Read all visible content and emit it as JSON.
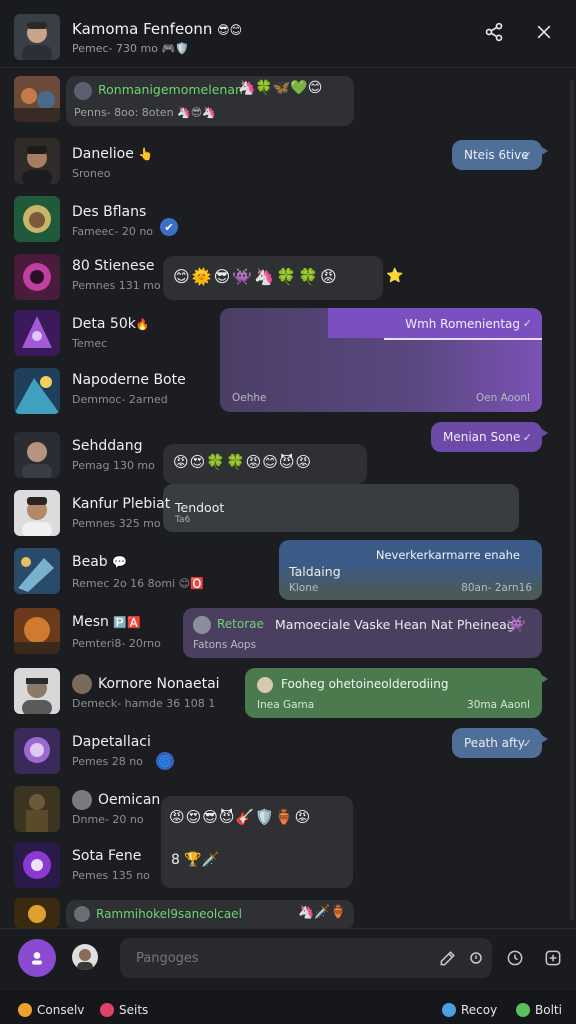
{
  "header": {
    "title": "Kamoma Fenfeonn",
    "title_emoji": "😎😊",
    "subtitle": "Pemec- 730 mo",
    "subtitle_emoji": "🎮🛡️",
    "share_icon": "share-icon",
    "close_icon": "close-icon"
  },
  "rows": [
    {
      "name": "Ronmanigemomelenan",
      "name_color": "#6fd36f",
      "emojis": "🦄🍀🦋💚😊",
      "sub": "Penns- 8oo: 8oten",
      "sub_emoji": "🦄😎🦄"
    },
    {
      "name": "Danelioe",
      "name_emoji": "👆",
      "sub": "Sroneo",
      "bubble": "Nteis 6tive",
      "tick": "✓"
    },
    {
      "name": "Des Bflans",
      "sub": "Fameec- 20 no",
      "badge": "✔"
    },
    {
      "name": "80 Stienese",
      "sub": "Pemnes 131 mo",
      "emojis": "😊🌞😎👾🦄🍀🍀😡",
      "side_emoji": "⭐"
    },
    {
      "name": "Deta 50k",
      "name_emoji": "🔥",
      "sub": "Temec",
      "bubble": "Wmh Romenientag",
      "tick": "✓"
    },
    {
      "name": "Napoderne Bote",
      "sub": "Demmoc- 2arned",
      "meta_left": "Oehhe",
      "meta_right": "Oen Aoonl"
    },
    {
      "bubble": "Menian Sone",
      "tick": "✓"
    },
    {
      "name": "Sehddang",
      "sub": "Pemag 130 mo",
      "emojis": "😡😍🍀🍀😡😊😈😡",
      "bubble": "Tendoot",
      "bubble2": "Ta6"
    },
    {
      "name": "Kanfur Plebiat",
      "sub": "Pemnes 325 mo"
    },
    {
      "name": "Beab",
      "name_emoji": "💬",
      "sub": "Remec 2o 16 8omi",
      "sub_emoji": "😊🅾️",
      "bubble": "Neverkerkarmarre enahe",
      "line1": "Taldaing",
      "line2": "Klone",
      "meta_right": "80an- 2arn16"
    },
    {
      "name": "Mesn",
      "name_emoji": "🅿️🅰️",
      "sub": "Pemteri8- 20rno",
      "bubble_label": "Retorae",
      "bubble": "Mamoeciale Vaske Hean Nat Pheineag",
      "bubble_sub": "Fatons Aops",
      "side_emoji": "👾"
    },
    {
      "name": "Kornore Nonaetai",
      "sub": "Demeck- hamde 36 108 1",
      "bubble": "Fooheg ohetoineolderodiing",
      "bubble_sub": "Inea Gama",
      "meta_right": "30ma Aaonl"
    },
    {
      "name": "Dapetallaci",
      "sub": "Pemes 28 no",
      "badge": "🌀",
      "bubble": "Peath afty",
      "tick": "✓"
    },
    {
      "name": "Oemican",
      "sub": "Dnme- 20 no",
      "emojis": "😡😍😎😈🎸🛡️🏺😡"
    },
    {
      "name": "Sota Fene",
      "sub": "Pemes 135 no",
      "emojis": "8 🏆🗡️"
    },
    {
      "name": "Rammihokel9saneolcael",
      "name_color": "#6fd36f",
      "emojis": "🦄🗡️🏺"
    }
  ],
  "composer": {
    "placeholder": "Pangoges",
    "edit_icon": "pencil-icon",
    "mic_icon": "mic-icon",
    "emoji_icon": "emoji-icon",
    "add_icon": "add-icon"
  },
  "footer": {
    "left1": "Conselv",
    "left1_color": "#f0a030",
    "left2": "Seits",
    "left2_color": "#e0436a",
    "right1": "Recoy",
    "right1_color": "#4aa0e0",
    "right2": "Bolti",
    "right2_color": "#5ac060"
  }
}
